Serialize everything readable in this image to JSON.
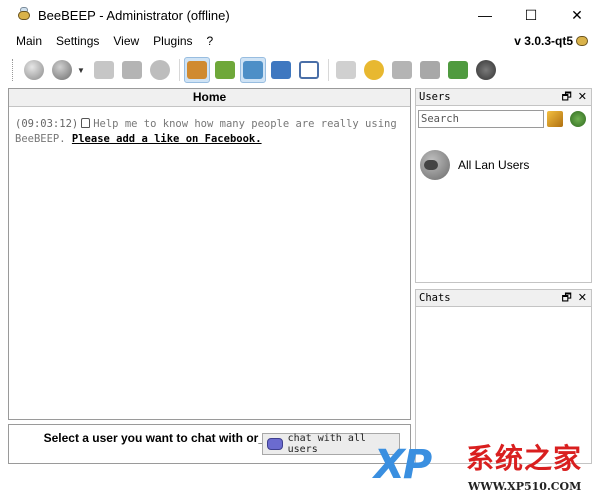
{
  "window": {
    "title": "BeeBEEP - Administrator (offline)",
    "controls": {
      "minimize": "—",
      "maximize": "☐",
      "close": "✕"
    }
  },
  "menu": {
    "items": [
      "Main",
      "Settings",
      "View",
      "Plugins",
      "?"
    ],
    "version": "v 3.0.3-qt5"
  },
  "toolbar": {
    "buttons": [
      {
        "name": "connect",
        "icon": "power-icon",
        "color": "#9a9a9a"
      },
      {
        "name": "status",
        "icon": "status-icon",
        "color": "#8c8c8c"
      },
      {
        "name": "send-file",
        "icon": "file-icon",
        "color": "#b0b0b0"
      },
      {
        "name": "share",
        "icon": "share-icon",
        "color": "#a8a8a8"
      },
      {
        "name": "network",
        "icon": "network-icon",
        "color": "#b8b8b8"
      },
      {
        "name": "users",
        "icon": "users-icon",
        "color": "#d08a30"
      },
      {
        "name": "groups",
        "icon": "groups-icon",
        "color": "#6fa83a"
      },
      {
        "name": "lan",
        "icon": "lan-icon",
        "color": "#4d8fc7"
      },
      {
        "name": "file-transfer",
        "icon": "transfer-icon",
        "color": "#3f78c0"
      },
      {
        "name": "log",
        "icon": "log-icon",
        "color": "#4a6fa8"
      },
      {
        "name": "home",
        "icon": "home-icon",
        "color": "#b0b0b0"
      },
      {
        "name": "messages",
        "icon": "speech-icon",
        "color": "#e8b830"
      },
      {
        "name": "screenshot",
        "icon": "camera-icon",
        "color": "#9a9a9a"
      },
      {
        "name": "download",
        "icon": "download-icon",
        "color": "#a0a0a0"
      },
      {
        "name": "notes",
        "icon": "notes-icon",
        "color": "#4f9a3f"
      },
      {
        "name": "webcam",
        "icon": "webcam-icon",
        "color": "#5a5a5a"
      }
    ]
  },
  "home": {
    "header": "Home",
    "message": {
      "time": "(09:03:12)",
      "text": "Help me to know how many people are really using BeeBEEP.",
      "link": "Please add a like on Facebook."
    }
  },
  "bottom": {
    "prompt": "Select a user you want to chat with or_",
    "chat_all": "chat with all users"
  },
  "users_dock": {
    "title": "Users",
    "search_placeholder": "Search",
    "items": [
      {
        "label": "All Lan Users"
      }
    ]
  },
  "chats_dock": {
    "title": "Chats"
  },
  "watermark": {
    "logo": "XP",
    "name": "系统之家",
    "url": "WWW.XP510.COM"
  }
}
